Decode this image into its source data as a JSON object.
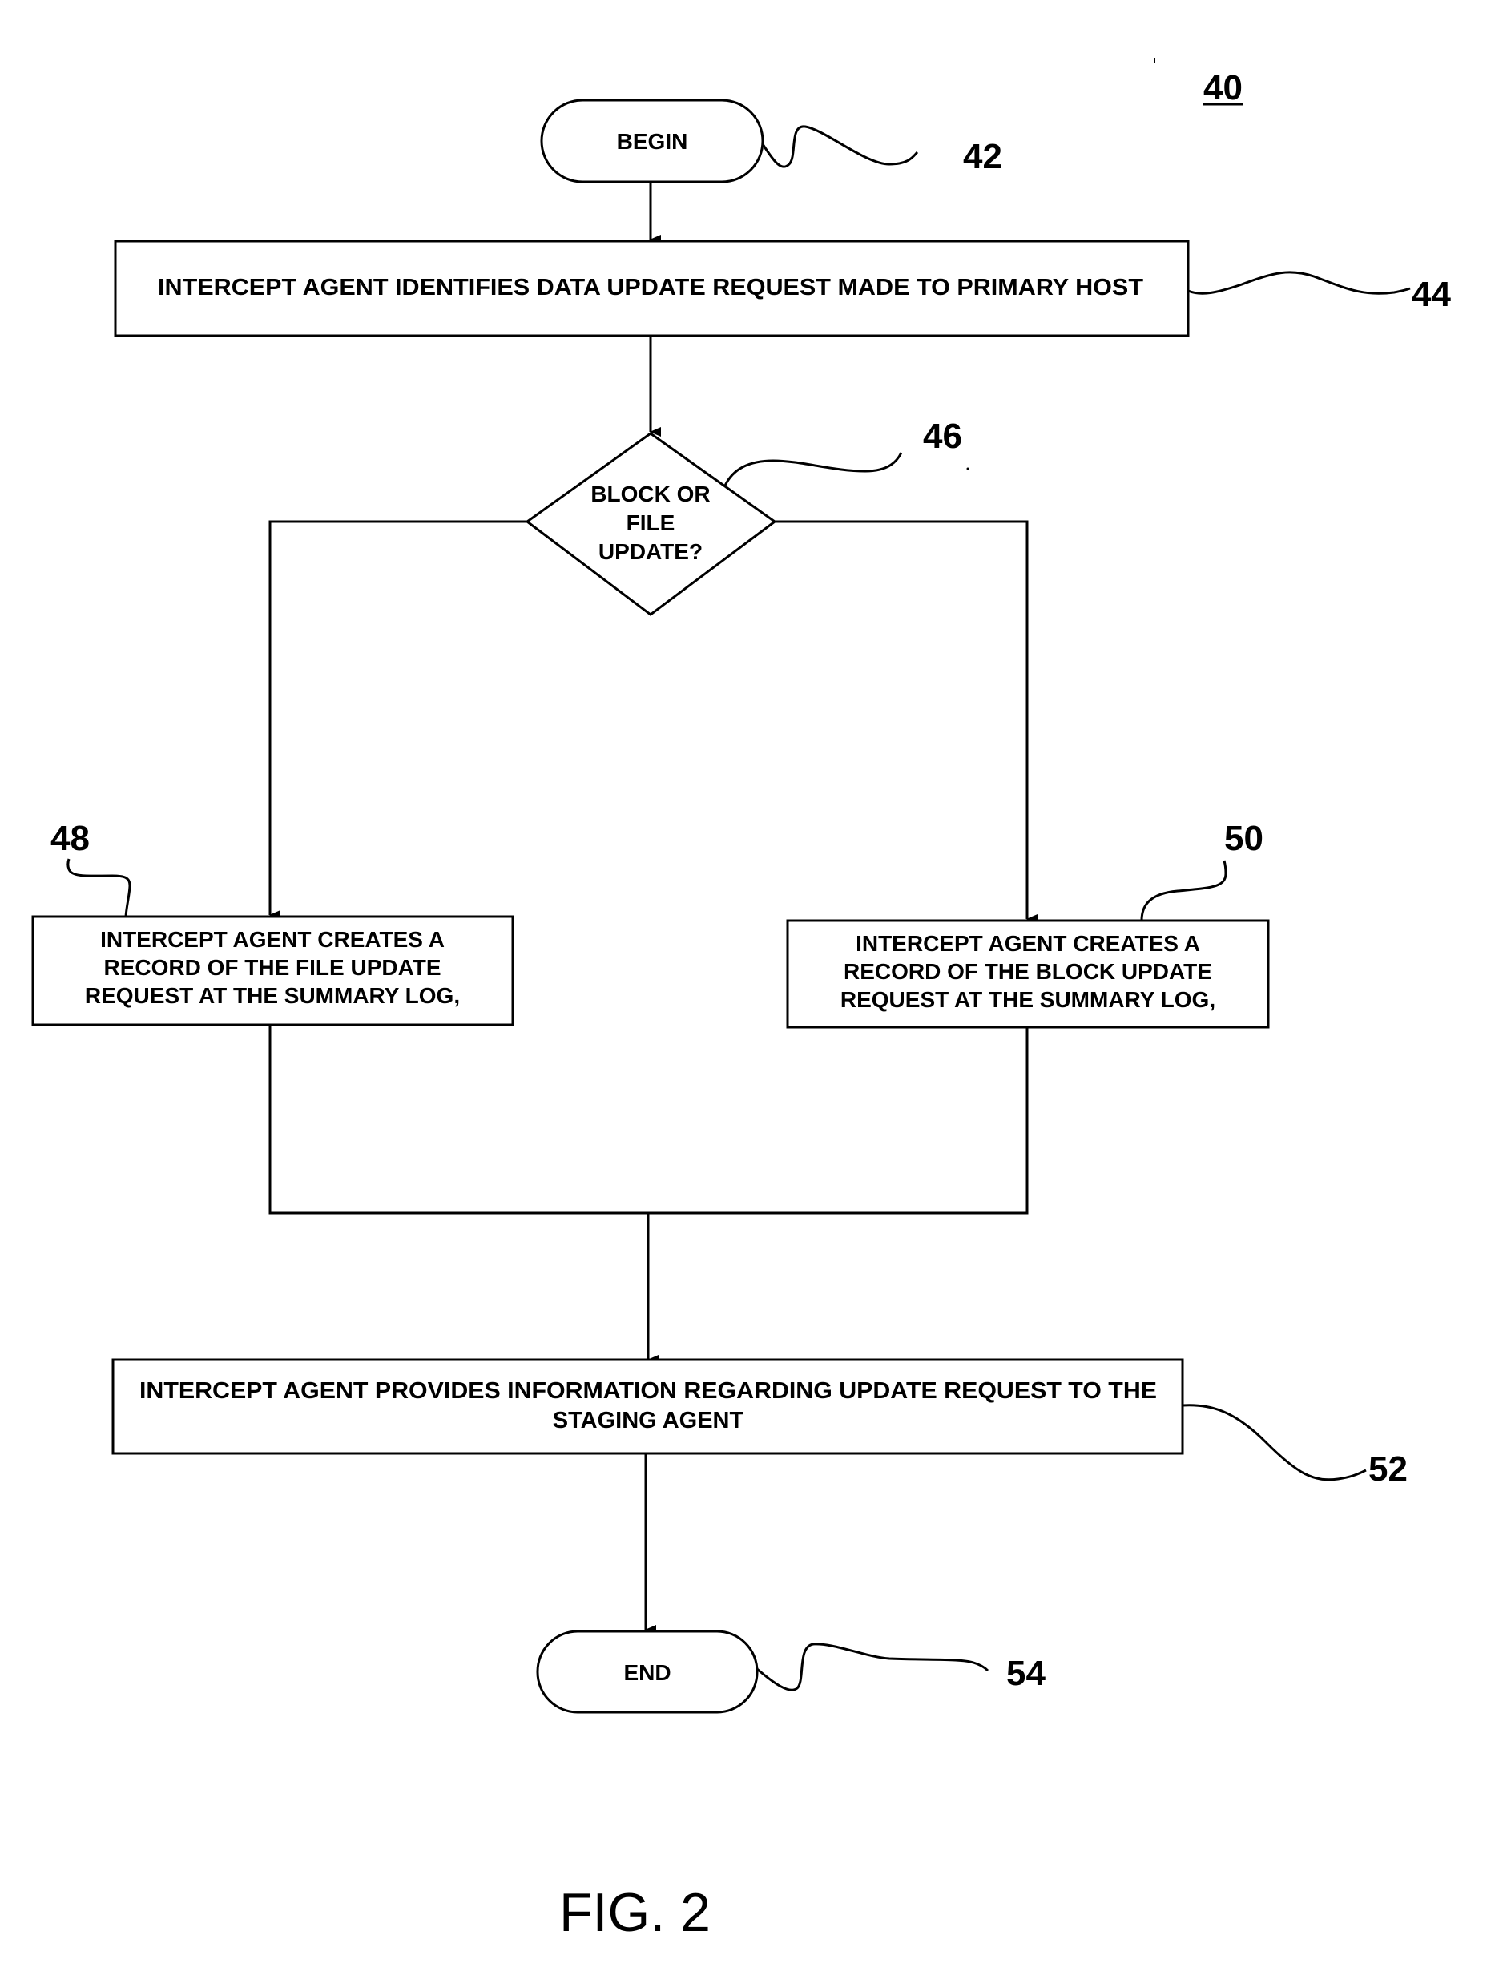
{
  "figure": {
    "number_label": "40",
    "caption": "FIG. 2"
  },
  "nodes": {
    "begin": {
      "text": "BEGIN",
      "ref": "42"
    },
    "identify": {
      "lines": [
        "INTERCEPT AGENT IDENTIFIES DATA UPDATE REQUEST MADE TO PRIMARY HOST"
      ],
      "ref": "44"
    },
    "decision": {
      "lines": [
        "BLOCK OR",
        "FILE",
        "UPDATE?"
      ],
      "ref": "46"
    },
    "file_record": {
      "lines": [
        "INTERCEPT AGENT CREATES A",
        "RECORD OF THE FILE UPDATE",
        "REQUEST AT THE SUMMARY LOG,"
      ],
      "ref": "48"
    },
    "block_record": {
      "lines": [
        "INTERCEPT AGENT CREATES A",
        "RECORD OF THE BLOCK UPDATE",
        "REQUEST AT THE SUMMARY LOG,"
      ],
      "ref": "50"
    },
    "provide": {
      "lines": [
        "INTERCEPT AGENT PROVIDES INFORMATION REGARDING UPDATE REQUEST TO THE",
        "STAGING AGENT"
      ],
      "ref": "52"
    },
    "end": {
      "text": "END",
      "ref": "54"
    }
  },
  "colors": {
    "ink": "#000000",
    "paper": "#ffffff"
  }
}
